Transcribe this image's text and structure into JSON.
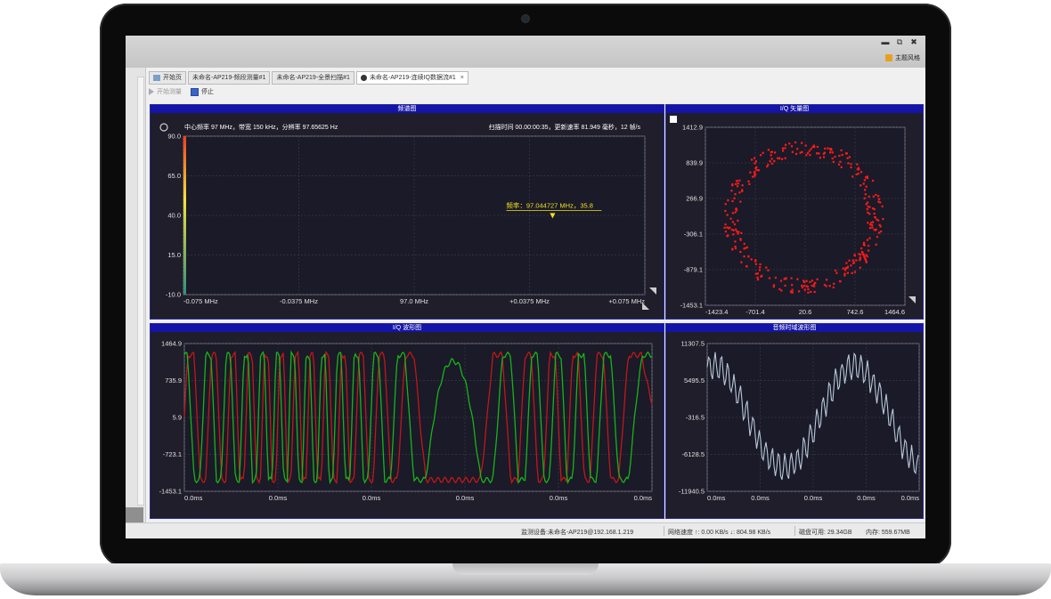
{
  "titlebar": {
    "minimize": "▬",
    "restore": "⧉",
    "close": "✖",
    "theme_label": "主题风格"
  },
  "tabs": [
    {
      "label": "开始页",
      "icon": "home-icon",
      "active": false
    },
    {
      "label": "未命名-AP219-频段测量#1",
      "active": false
    },
    {
      "label": "未命名-AP219-全景扫描#1",
      "active": false
    },
    {
      "label": "未命名-AP219-连续IQ数据流#1",
      "active": true,
      "close": "×"
    }
  ],
  "toolbar": {
    "start_label": "开始测量",
    "stop_label": "停止"
  },
  "spectrum": {
    "title": "频谱图",
    "info_left": "中心频率 97 MHz，带宽 150 kHz，分辨率 97.65625 Hz",
    "info_right": "扫描时间 00.00:00:35，更新速率 81.949 毫秒，12 帧/s",
    "marker_label": "频率：97.044727 MHz，35.8",
    "y_ticks": [
      "90.0",
      "65.0",
      "40.0",
      "15.0",
      "-10.0"
    ],
    "x_ticks": [
      "-0.075 MHz",
      "-0.0375 MHz",
      "97.0 MHz",
      "+0.0375 MHz",
      "+0.075 MHz"
    ]
  },
  "constellation": {
    "title": "I/Q 矢量图",
    "y_ticks": [
      "1412.9",
      "839.9",
      "266.9",
      "-306.1",
      "-879.1",
      "-1453.1"
    ],
    "x_ticks": [
      "-1423.4",
      "-701.4",
      "20.6",
      "742.6",
      "1464.6"
    ]
  },
  "iq_wave": {
    "title": "I/Q 波形图",
    "y_ticks": [
      "1464.9",
      "735.9",
      "5.9",
      "-723.1",
      "-1453.1"
    ],
    "x_ticks": [
      "0.0ms",
      "0.0ms",
      "0.0ms",
      "0.0ms",
      "0.0ms",
      "0.0ms"
    ]
  },
  "audio_wave": {
    "title": "音频时域波形图",
    "y_ticks": [
      "11307.5",
      "5495.5",
      "-316.5",
      "-6128.5",
      "-11940.5"
    ],
    "x_ticks": [
      "0.0ms",
      "0.0ms",
      "0.0ms",
      "0.0ms",
      "0.0ms"
    ]
  },
  "status": {
    "device": "监测设备:未命名-AP219@192.168.1.219",
    "network": "网络速度 ↑: 0.00 KB/s ↓: 804.98 KB/s",
    "disk": "磁盘可用: 29.34GB",
    "memory": "内存: 559.67MB"
  },
  "colors": {
    "panel_header": "#1414a8",
    "panel_bg": "#1f1e2a",
    "iq_i": "#c01818",
    "iq_q": "#18b418",
    "scatter": "#ff1a1a",
    "audio": "#b8c8d8",
    "marker": "#f0e020"
  }
}
